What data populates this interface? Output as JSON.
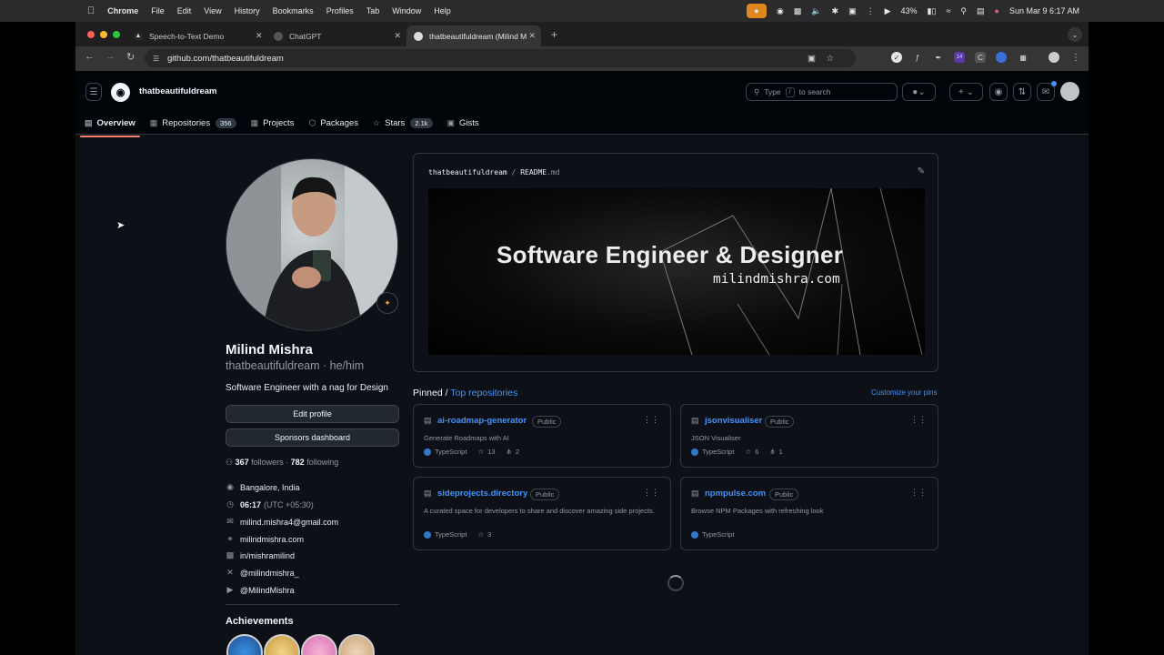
{
  "macmenu": {
    "app": "Chrome",
    "items": [
      "File",
      "Edit",
      "View",
      "History",
      "Bookmarks",
      "Profiles",
      "Tab",
      "Window",
      "Help"
    ],
    "battery": "43%",
    "datetime": "Sun Mar 9  6:17 AM"
  },
  "browser": {
    "tabs": [
      {
        "title": "Speech-to-Text Demo"
      },
      {
        "title": "ChatGPT"
      },
      {
        "title": "thatbeautifuldream (Milind M"
      }
    ],
    "url": "github.com/thatbeautifuldream",
    "ext_count": "14"
  },
  "header": {
    "username": "thatbeautifuldream",
    "search_prefix": "Type",
    "search_key": "/",
    "search_suffix": "to search"
  },
  "nav": {
    "overview": "Overview",
    "repositories": "Repositories",
    "repositories_count": "356",
    "projects": "Projects",
    "packages": "Packages",
    "stars": "Stars",
    "stars_count": "2.1k",
    "gists": "Gists"
  },
  "profile": {
    "name": "Milind Mishra",
    "login": "thatbeautifuldream · he/him",
    "bio": "Software Engineer with a nag for Design",
    "edit_button": "Edit profile",
    "sponsors_button": "Sponsors dashboard",
    "followers": "367",
    "followers_label": "followers ·",
    "following": "782",
    "following_label": "following",
    "location": "Bangalore, India",
    "time": "06:17",
    "tz": "(UTC +05:30)",
    "email": "milind.mishra4@gmail.com",
    "website": "milindmishra.com",
    "linkedin": "in/mishramilind",
    "x": "@milindmishra_",
    "youtube": "@MilindMishra",
    "achievements": "Achievements"
  },
  "readme": {
    "owner": "thatbeautifuldream",
    "sep": "/",
    "file": "README",
    "ext": ".md",
    "banner_title": "Software Engineer & Designer",
    "banner_sub": "milindmishra.com"
  },
  "pinned": {
    "label": "Pinned /",
    "link": "Top repositories",
    "customize": "Customize your pins",
    "repos": [
      {
        "name": "ai-roadmap-generator",
        "visibility": "Public",
        "desc": "Generate Roadmaps with AI",
        "lang": "TypeScript",
        "stars": "13",
        "forks": "2"
      },
      {
        "name": "jsonvisualiser",
        "visibility": "Public",
        "desc": "JSON Visualiser",
        "lang": "TypeScript",
        "stars": "6",
        "forks": "1"
      },
      {
        "name": "sideprojects.directory",
        "visibility": "Public",
        "desc": "A curated space for developers to share and discover amazing side projects.",
        "lang": "TypeScript",
        "stars": "3"
      },
      {
        "name": "npmpulse.com",
        "visibility": "Public",
        "desc": "Browse NPM Packages with refreshing look",
        "lang": "TypeScript"
      }
    ]
  }
}
